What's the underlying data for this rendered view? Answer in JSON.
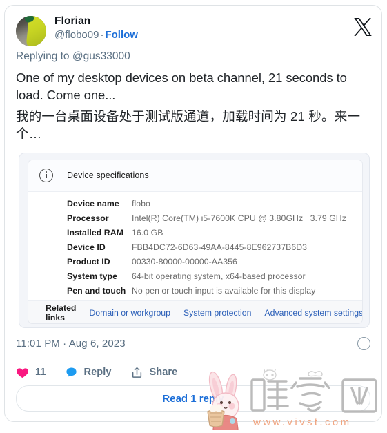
{
  "tweet": {
    "display_name": "Florian",
    "handle": "@flobo09",
    "separator": "·",
    "follow_label": "Follow",
    "replying_to_prefix": "Replying to ",
    "replying_to_mention": "@gus33000",
    "text_en": "One of my desktop devices on beta channel, 21 seconds to load. Come one...",
    "text_zh": "我的一台桌面设备处于测试版通道，加载时间为 21 秒。来一个…",
    "timestamp": "11:01 PM · Aug 6, 2023",
    "read_replies_label": "Read 1 reply",
    "x_logo_name": "x-logo"
  },
  "actions": [
    {
      "icon": "heart-icon",
      "label": "11",
      "color": "#f91880"
    },
    {
      "icon": "reply-icon",
      "label": "Reply",
      "color": "#1d9bf0"
    },
    {
      "icon": "share-icon",
      "label": "Share",
      "color": "#5b7083"
    }
  ],
  "embedded_screenshot": {
    "card_title": "Device specifications",
    "info_icon": "info-circle-icon",
    "specs": [
      {
        "label": "Device name",
        "value": "flobo"
      },
      {
        "label": "Processor",
        "value": "Intel(R) Core(TM) i5-7600K CPU @ 3.80GHz   3.79 GHz"
      },
      {
        "label": "Installed RAM",
        "value": "16.0 GB"
      },
      {
        "label": "Device ID",
        "value": "FBB4DC72-6D63-49AA-8445-8E962737B6D3"
      },
      {
        "label": "Product ID",
        "value": "00330-80000-00000-AA356"
      },
      {
        "label": "System type",
        "value": "64-bit operating system, x64-based processor"
      },
      {
        "label": "Pen and touch",
        "value": "No pen or touch input is available for this display"
      }
    ],
    "related": {
      "title": "Related links",
      "links": [
        "Domain or workgroup",
        "System protection",
        "Advanced system settings"
      ]
    }
  },
  "watermark": {
    "text_cn": "唯爱网",
    "url": "www.vivst.com",
    "mascot": "bunny-mascot"
  },
  "colors": {
    "link_blue": "#1d6fd8",
    "heart_pink": "#f91880",
    "reply_blue": "#1d9bf0",
    "muted_text": "#5b7083",
    "win_link_blue": "#2b5fb8",
    "watermark_orange": "#f0a07a"
  }
}
